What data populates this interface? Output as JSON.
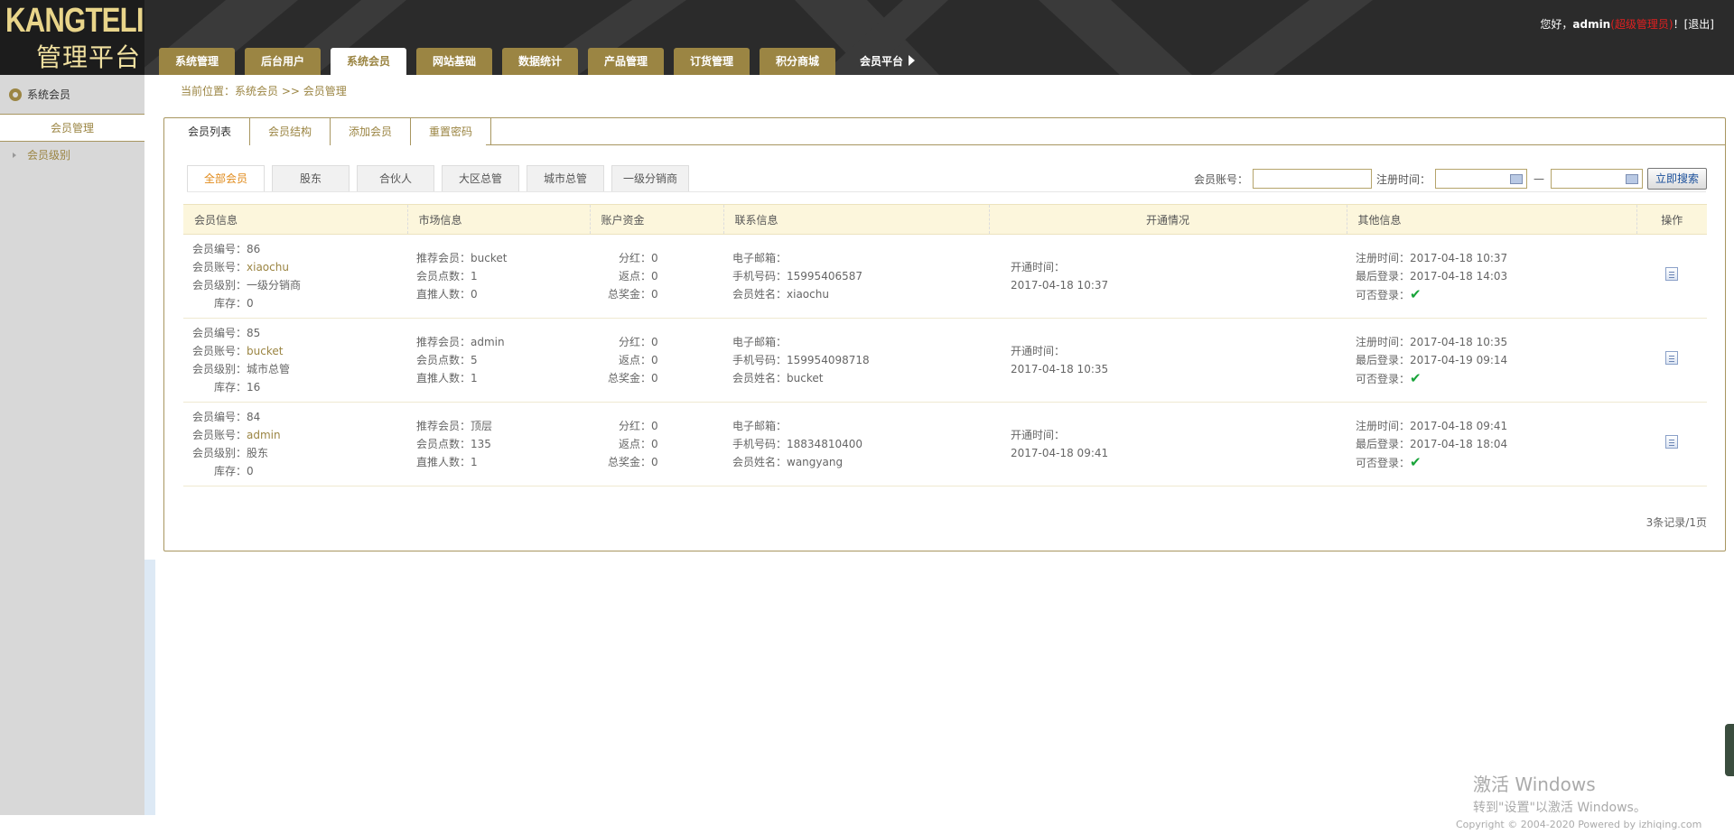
{
  "header": {
    "logo_line1": "KANGTELI",
    "logo_line2": "管理平台",
    "user_greeting": "您好，",
    "username": "admin",
    "role": "(超级管理员)",
    "exclaim": "！",
    "logout": "[退出]"
  },
  "topnav": [
    {
      "label": "系统管理"
    },
    {
      "label": "后台用户"
    },
    {
      "label": "系统会员"
    },
    {
      "label": "网站基础"
    },
    {
      "label": "数据统计"
    },
    {
      "label": "产品管理"
    },
    {
      "label": "订货管理"
    },
    {
      "label": "积分商城"
    },
    {
      "label": "会员平台"
    }
  ],
  "sidebar": {
    "section": "系统会员",
    "items": [
      {
        "label": "会员管理"
      },
      {
        "label": "会员级别"
      }
    ]
  },
  "breadcrumb": "当前位置：系统会员 >> 会员管理",
  "panel_tabs": [
    {
      "label": "会员列表"
    },
    {
      "label": "会员结构"
    },
    {
      "label": "添加会员"
    },
    {
      "label": "重置密码"
    }
  ],
  "filters": [
    {
      "label": "全部会员"
    },
    {
      "label": "股东"
    },
    {
      "label": "合伙人"
    },
    {
      "label": "大区总管"
    },
    {
      "label": "城市总管"
    },
    {
      "label": "一级分销商"
    }
  ],
  "search": {
    "account_label": "会员账号：",
    "account_value": "",
    "regtime_label": "注册时间：",
    "dash": "—",
    "button": "立即搜索"
  },
  "table": {
    "headers": [
      "会员信息",
      "市场信息",
      "账户资金",
      "联系信息",
      "开通情况",
      "其他信息",
      "操作"
    ],
    "labels": {
      "id": "会员编号：",
      "account": "会员账号：",
      "level": "会员级别：",
      "stock": "库存：",
      "referrer": "推荐会员：",
      "points": "会员点数：",
      "direct": "直推人数：",
      "dividend": "分红：",
      "rebate": "返点：",
      "bonus": "总奖金：",
      "email": "电子邮箱：",
      "phone": "手机号码：",
      "name": "会员姓名：",
      "opened": "开通时间：",
      "regtime": "注册时间：",
      "lastlogin": "最后登录：",
      "canlogin": "可否登录："
    },
    "rows": [
      {
        "id": "86",
        "account": "xiaochu",
        "level": "一级分销商",
        "stock": "0",
        "referrer": "bucket",
        "points": "1",
        "direct": "0",
        "dividend": "0",
        "rebate": "0",
        "bonus": "0",
        "email": "",
        "phone": "15995406587",
        "name": "xiaochu",
        "opened": "2017-04-18 10:37",
        "regtime": "2017-04-18 10:37",
        "lastlogin": "2017-04-18 14:03",
        "canlogin": "✔"
      },
      {
        "id": "85",
        "account": "bucket",
        "level": "城市总管",
        "stock": "16",
        "referrer": "admin",
        "points": "5",
        "direct": "1",
        "dividend": "0",
        "rebate": "0",
        "bonus": "0",
        "email": "",
        "phone": "159954098718",
        "name": "bucket",
        "opened": "2017-04-18 10:35",
        "regtime": "2017-04-18 10:35",
        "lastlogin": "2017-04-19 09:14",
        "canlogin": "✔"
      },
      {
        "id": "84",
        "account": "admin",
        "level": "股东",
        "stock": "0",
        "referrer": "顶层",
        "points": "135",
        "direct": "1",
        "dividend": "0",
        "rebate": "0",
        "bonus": "0",
        "email": "",
        "phone": "18834810400",
        "name": "wangyang",
        "opened": "2017-04-18 09:41",
        "regtime": "2017-04-18 09:41",
        "lastlogin": "2017-04-18 18:04",
        "canlogin": "✔"
      }
    ]
  },
  "records": "3条记录/1页",
  "watermark": {
    "line1": "激活 Windows",
    "line2": "转到\"设置\"以激活 Windows。"
  },
  "copyright": "Copyright © 2004-2020 Powered by izhiqing.com"
}
